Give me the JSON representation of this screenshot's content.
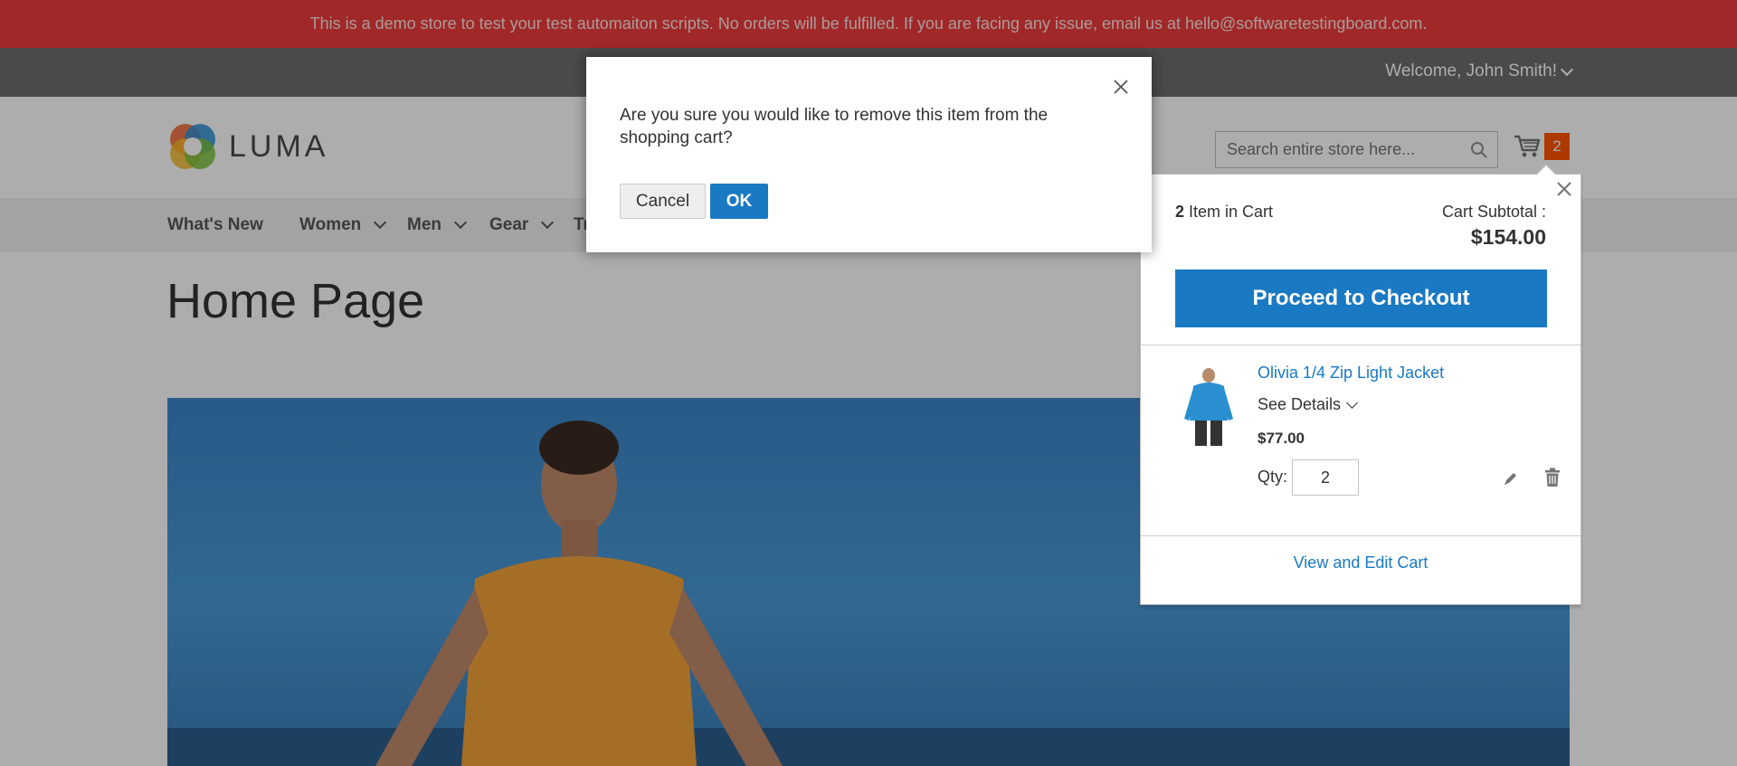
{
  "notice": {
    "text": "This is a demo store to test your test automaiton scripts. No orders will be fulfilled. If you are facing any issue, email us at hello@softwaretestingboard.com."
  },
  "header": {
    "welcome": "Welcome, John Smith!",
    "logo_text": "LUMA",
    "search_placeholder": "Search entire store here...",
    "cart_count": "2"
  },
  "nav": {
    "items": [
      {
        "label": "What's New"
      },
      {
        "label": "Women"
      },
      {
        "label": "Men"
      },
      {
        "label": "Gear"
      },
      {
        "label": "Tr"
      }
    ]
  },
  "page": {
    "title": "Home Page"
  },
  "minicart": {
    "count": "2",
    "count_label": "Item in Cart",
    "subtotal_label": "Cart Subtotal :",
    "subtotal_value": "$154.00",
    "checkout_label": "Proceed to Checkout",
    "item": {
      "name": "Olivia 1/4 Zip Light Jacket",
      "details_label": "See Details",
      "price": "$77.00",
      "qty_label": "Qty:",
      "qty_value": "2"
    },
    "view_cart_label": "View and Edit Cart"
  },
  "modal": {
    "message": "Are you sure you would like to remove this item from the shopping cart?",
    "cancel_label": "Cancel",
    "ok_label": "OK"
  },
  "colors": {
    "notice_bg": "#ee3b3b",
    "primary": "#1979c3",
    "cart_badge": "#ff5501"
  }
}
